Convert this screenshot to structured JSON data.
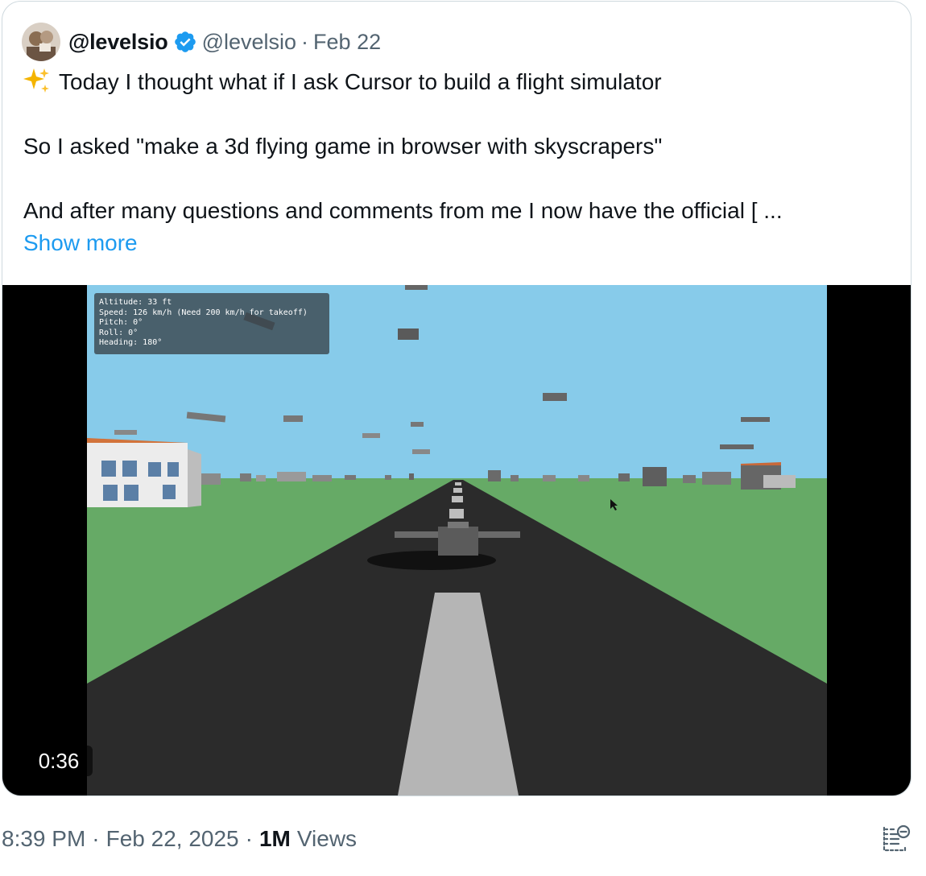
{
  "quote": {
    "author": {
      "name": "@levelsio",
      "handle": "@levelsio",
      "separator": "·",
      "date": "Feb 22"
    },
    "text": {
      "line1": "Today I thought what if I ask Cursor to build a flight simulator",
      "line2": "So I asked  \"make a 3d flying game in browser with skyscrapers\"",
      "line3": "And after many questions and comments from me I now have the official [ ...",
      "show_more": "Show more"
    },
    "video": {
      "duration": "0:36",
      "hud": {
        "altitude": "Altitude: 33 ft",
        "speed": "Speed: 126 km/h (Need 200 km/h for takeoff)",
        "pitch": "Pitch: 0°",
        "roll": "Roll: 0°",
        "heading": "Heading: 180°"
      }
    }
  },
  "footer": {
    "time": "8:39 PM",
    "sep1": "·",
    "date": "Feb 22, 2025",
    "sep2": "·",
    "views_count": "1M",
    "views_label": "Views"
  },
  "icons": {
    "verified": "verified-badge-icon",
    "sparkles": "sparkles-emoji-icon",
    "reader": "reader-mode-icon"
  },
  "colors": {
    "link": "#1d9bf0",
    "secondary_text": "#536471",
    "verified_blue": "#1d9bf0",
    "sky": "#87cbea",
    "grass": "#66aa66",
    "runway": "#2a2a2a"
  }
}
